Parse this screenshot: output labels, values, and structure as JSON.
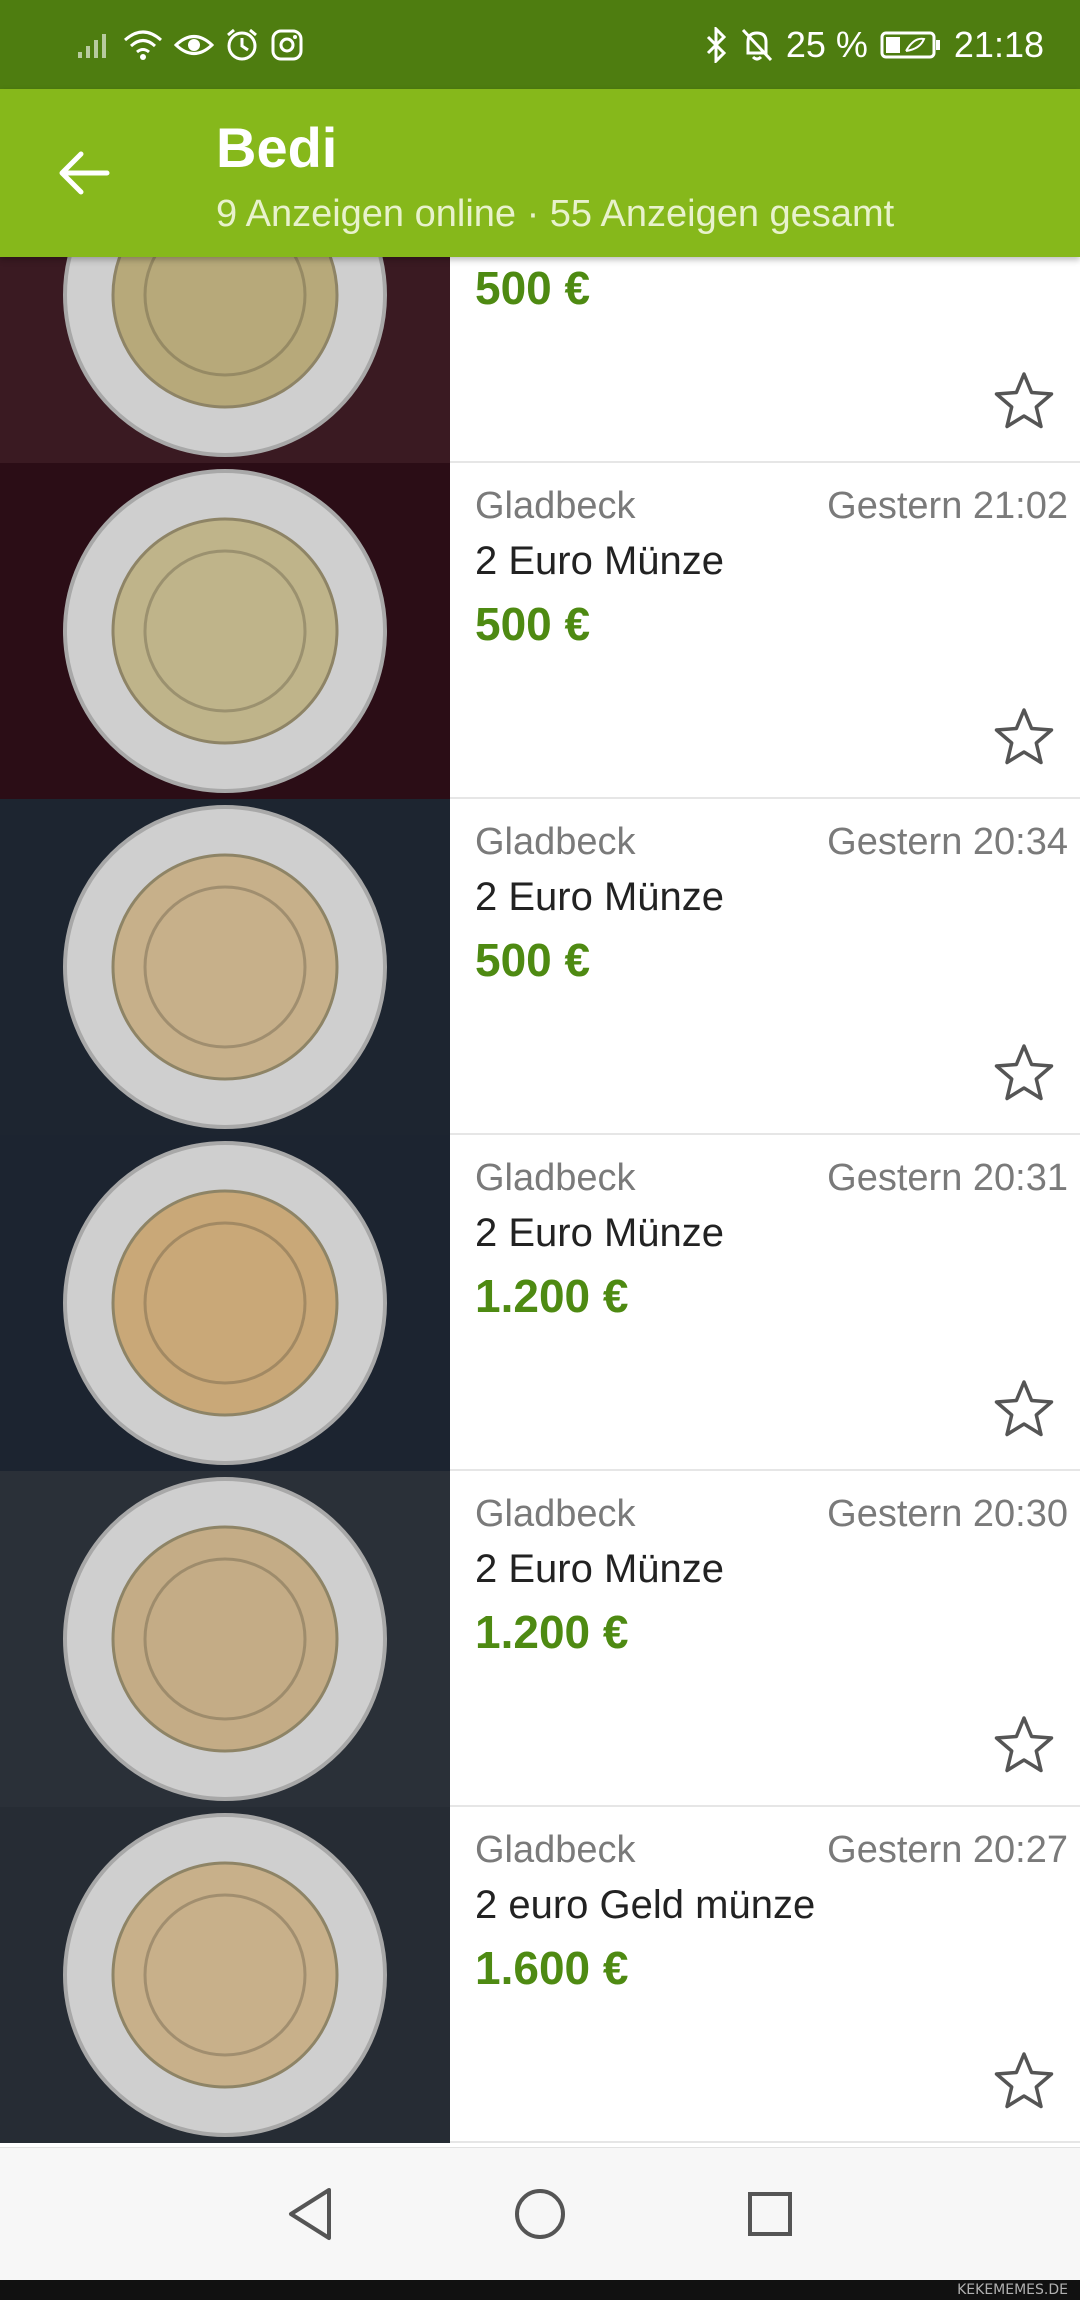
{
  "status_bar": {
    "battery": "25 %",
    "time": "21:18",
    "icons": [
      "signal-icon",
      "wifi-icon",
      "eye-icon",
      "alarm-icon",
      "instagram-icon",
      "bluetooth-icon",
      "mute-icon",
      "battery-icon"
    ]
  },
  "app_bar": {
    "title": "Bedi",
    "subtitle": "9 Anzeigen online · 55 Anzeigen gesamt"
  },
  "listings": [
    {
      "location": "",
      "time": "",
      "title": "",
      "price": "500 €",
      "coin_tone": "#b7a97a",
      "bg": "#3a1a22"
    },
    {
      "location": "Gladbeck",
      "time": "Gestern 21:02",
      "title": "2 Euro Münze",
      "price": "500 €",
      "coin_tone": "#bfb48a",
      "bg": "#2b0d16"
    },
    {
      "location": "Gladbeck",
      "time": "Gestern 20:34",
      "title": "2 Euro Münze",
      "price": "500 €",
      "coin_tone": "#c7b08a",
      "bg": "#1d2530"
    },
    {
      "location": "Gladbeck",
      "time": "Gestern 20:31",
      "title": "2 Euro Münze",
      "price": "1.200 €",
      "coin_tone": "#c9a878",
      "bg": "#1c2430"
    },
    {
      "location": "Gladbeck",
      "time": "Gestern 20:30",
      "title": "2 Euro Münze",
      "price": "1.200 €",
      "coin_tone": "#c4ac86",
      "bg": "#2a3038"
    },
    {
      "location": "Gladbeck",
      "time": "Gestern 20:27",
      "title": "2 euro Geld münze",
      "price": "1.600 €",
      "coin_tone": "#c8b08a",
      "bg": "#262c34"
    }
  ],
  "nav_bar": {
    "buttons": [
      "back-triangle-icon",
      "home-circle-icon",
      "recents-square-icon"
    ]
  },
  "watermark": "KEKEMEMES.DE",
  "colors": {
    "status_bar": "#4e7d10",
    "app_bar": "#86b81b",
    "price": "#4e8a12",
    "meta_text": "#7a7a7a"
  }
}
